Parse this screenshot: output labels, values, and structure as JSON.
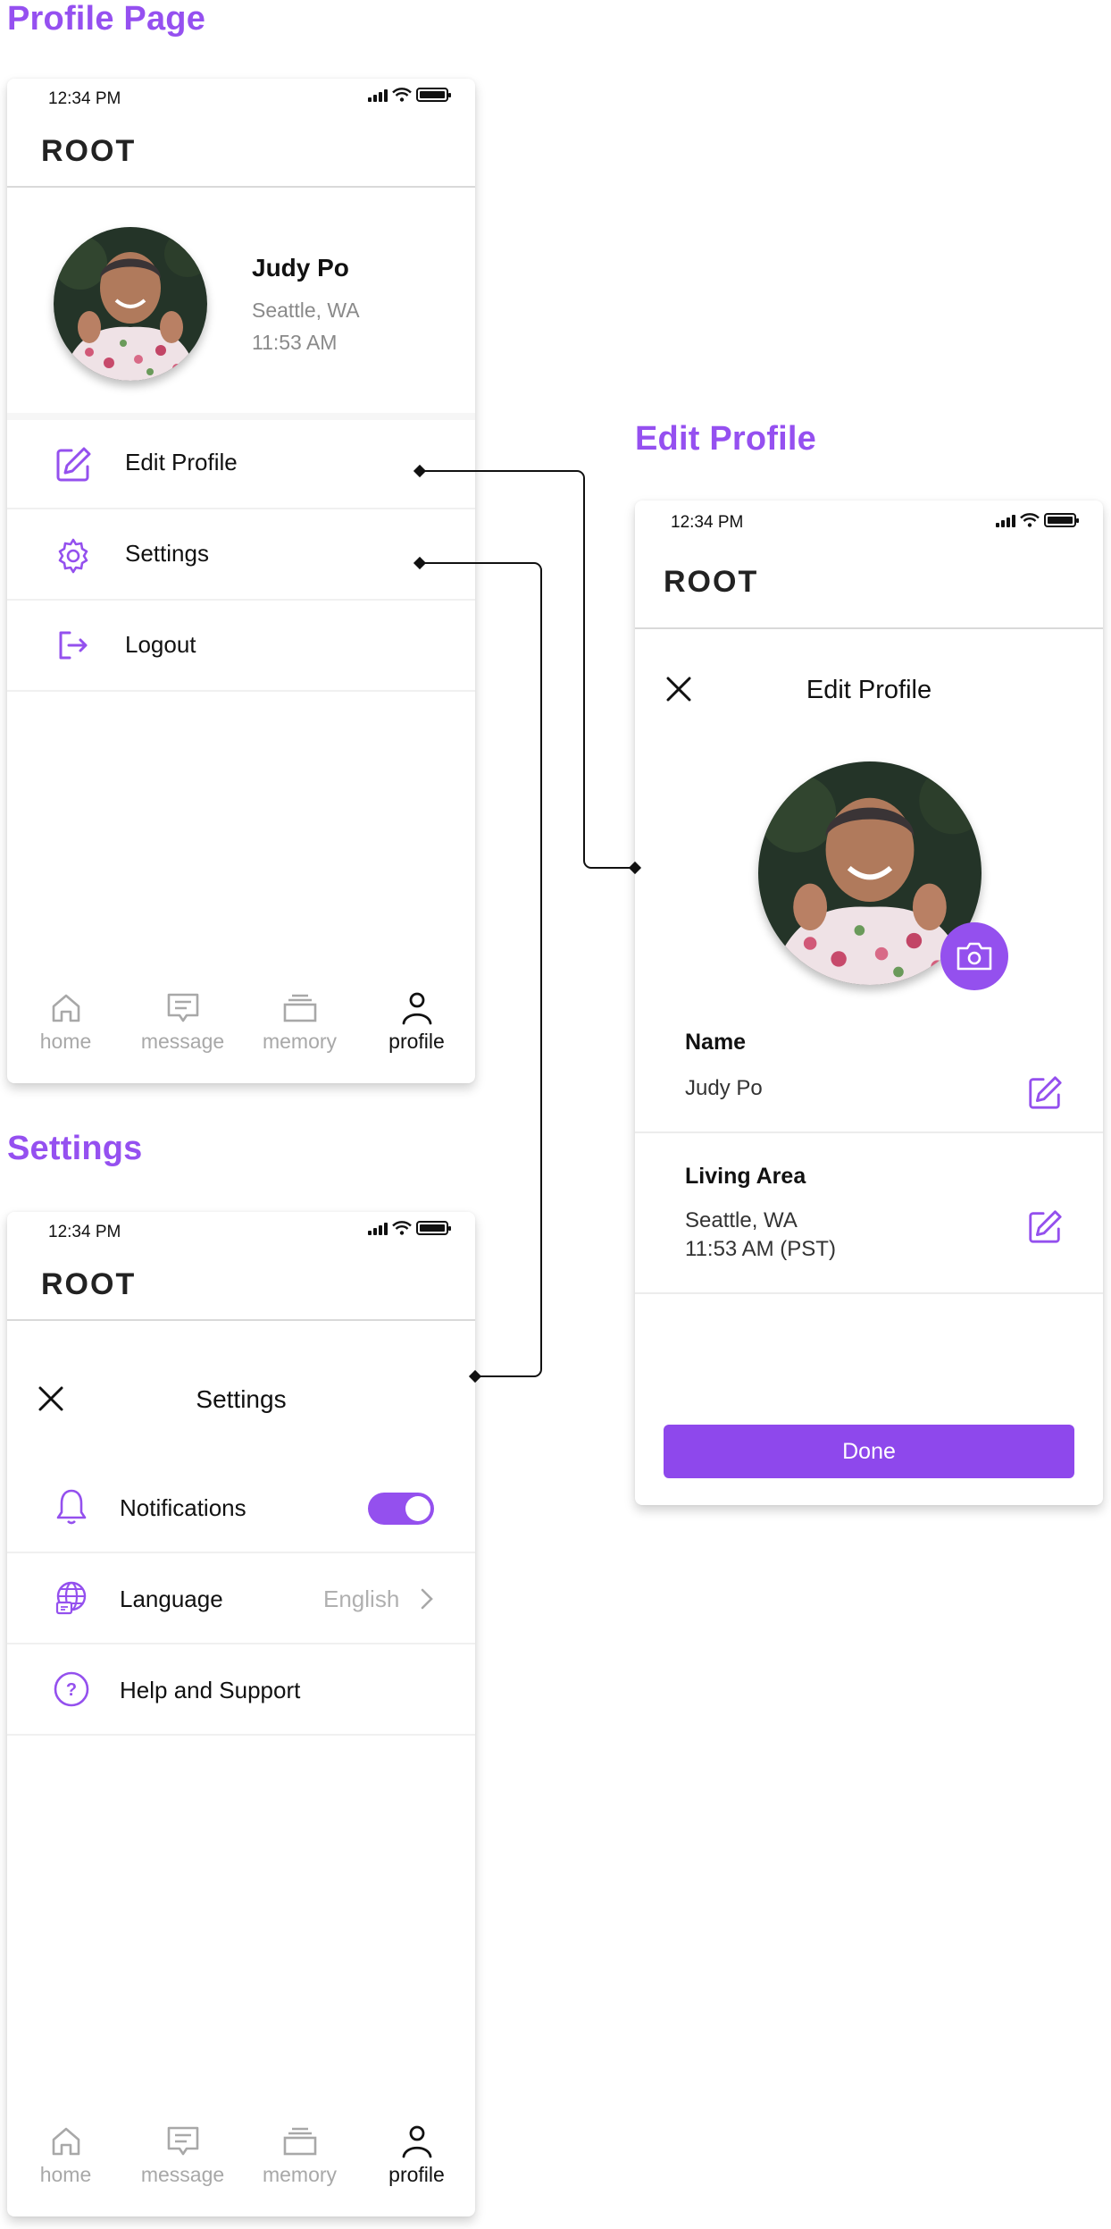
{
  "sections": {
    "profile_page": "Profile Page",
    "edit_profile": "Edit Profile",
    "settings": "Settings"
  },
  "status_bar": {
    "time": "12:34 PM"
  },
  "app": {
    "title": "ROOT"
  },
  "profile": {
    "name": "Judy Po",
    "location": "Seattle, WA",
    "local_time": "11:53 AM",
    "menu": [
      {
        "label": "Edit Profile",
        "icon": "edit-icon"
      },
      {
        "label": "Settings",
        "icon": "gear-icon"
      },
      {
        "label": "Logout",
        "icon": "logout-icon"
      }
    ]
  },
  "nav": [
    {
      "label": "home",
      "icon": "home-icon"
    },
    {
      "label": "message",
      "icon": "message-icon"
    },
    {
      "label": "memory",
      "icon": "memory-icon"
    },
    {
      "label": "profile",
      "icon": "profile-icon",
      "active": true
    }
  ],
  "edit_profile": {
    "title": "Edit Profile",
    "name_label": "Name",
    "name_value": "Judy Po",
    "area_label": "Living Area",
    "area_line1": "Seattle, WA",
    "area_line2": "11:53 AM (PST)",
    "done": "Done"
  },
  "settings": {
    "title": "Settings",
    "notifications": {
      "label": "Notifications",
      "enabled": true
    },
    "language": {
      "label": "Language",
      "value": "English"
    },
    "help": {
      "label": "Help and Support"
    }
  },
  "colors": {
    "accent": "#9450ee",
    "inactive": "#a8a8a8"
  }
}
